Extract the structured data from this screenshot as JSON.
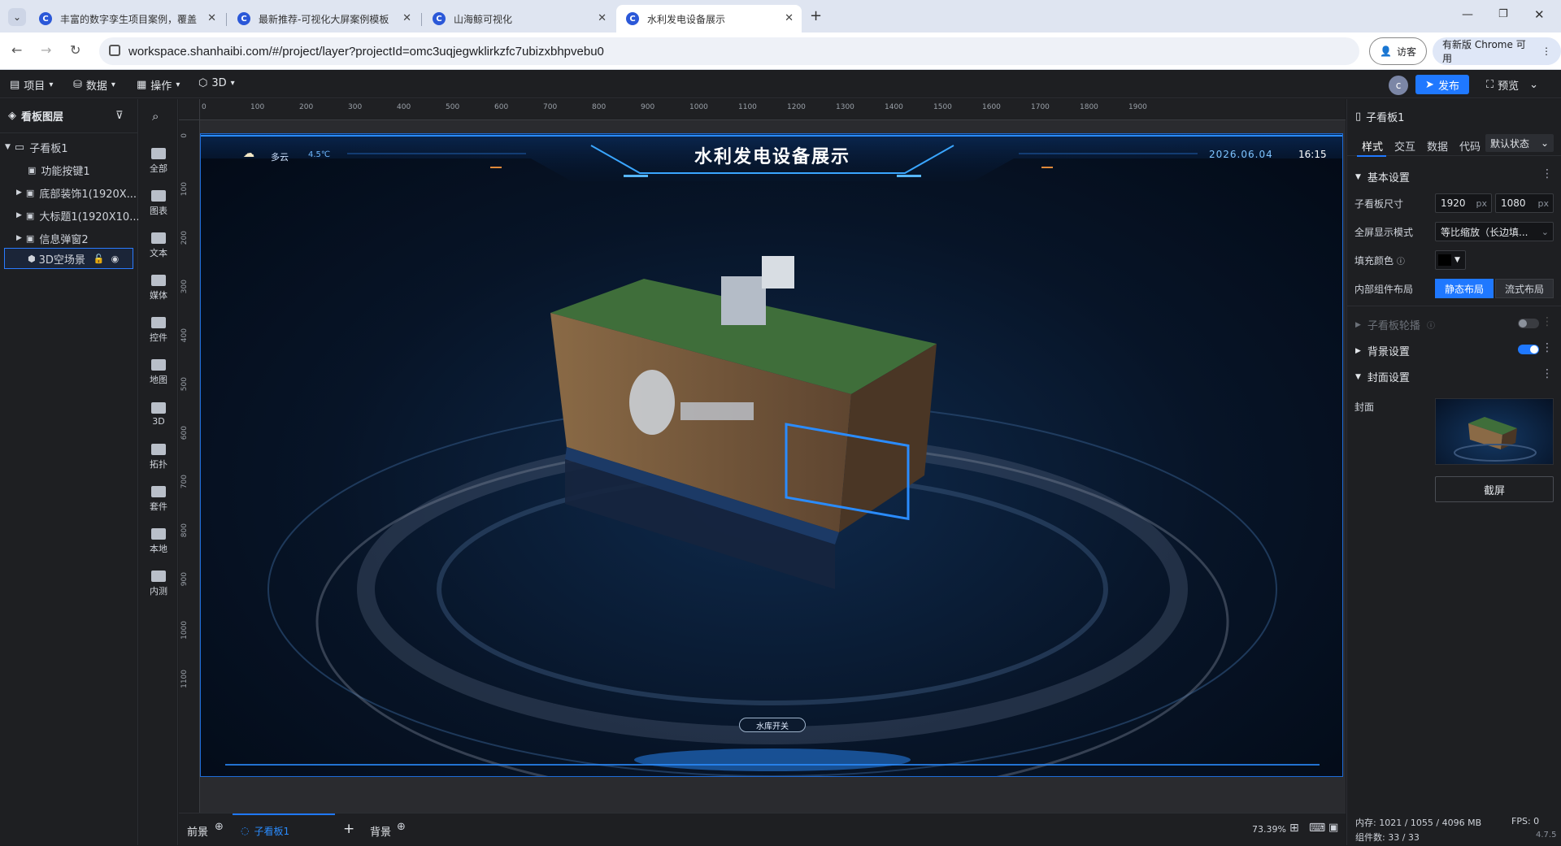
{
  "browser": {
    "tabs": [
      {
        "title": "丰富的数字孪生项目案例，覆盖"
      },
      {
        "title": "最新推荐-可视化大屏案例模板"
      },
      {
        "title": "山海鲸可视化"
      },
      {
        "title": "水利发电设备展示"
      }
    ],
    "url": "workspace.shanhaibi.com/#/project/layer?projectId=omc3uqjegwklirkzfc7ubizxbhpvebu0",
    "visitor_label": "访客",
    "update_label": "有新版 Chrome 可用"
  },
  "appbar": {
    "menus": [
      "项目",
      "数据",
      "操作",
      "3D"
    ],
    "avatar_letter": "c",
    "publish_label": "发布",
    "preview_label": "预览"
  },
  "layers": {
    "title": "看板图层",
    "items": [
      {
        "label": "子看板1"
      },
      {
        "label": "功能按键1"
      },
      {
        "label": "底部装饰1(1920X..."
      },
      {
        "label": "大标题1(1920X10..."
      },
      {
        "label": "信息弹窗2"
      },
      {
        "label": "3D空场景"
      }
    ]
  },
  "tools": [
    "全部",
    "图表",
    "文本",
    "媒体",
    "控件",
    "地图",
    "3D",
    "拓扑",
    "套件",
    "本地",
    "内测"
  ],
  "ruler": {
    "top": [
      "0",
      "100",
      "200",
      "300",
      "400",
      "500",
      "600",
      "700",
      "800",
      "900",
      "1000",
      "1100",
      "1200",
      "1300",
      "1400",
      "1500",
      "1600",
      "1700",
      "1800",
      "1900"
    ],
    "left": [
      "0",
      "100",
      "200",
      "300",
      "400",
      "500",
      "600",
      "700",
      "800",
      "900",
      "1000",
      "1100"
    ]
  },
  "dashboard": {
    "title": "水利发电设备展示",
    "weather": "多云",
    "temperature": "4.5℃",
    "date": "2026.06.04",
    "time": "16:15",
    "reservoir_button": "水库开关"
  },
  "bottom": {
    "foreground": "前景",
    "subboard_tab": "子看板1",
    "background": "背景",
    "zoom": "73.39%"
  },
  "props": {
    "title": "子看板1",
    "tabs": [
      "样式",
      "交互",
      "数据",
      "代码"
    ],
    "state_select": "默认状态",
    "basic_section": "基本设置",
    "size_label": "子看板尺寸",
    "width": "1920",
    "height": "1080",
    "unit": "px",
    "fullscreen_label": "全屏显示模式",
    "fullscreen_value": "等比缩放（长边填...",
    "fill_label": "填充颜色",
    "fill_color": "#000000",
    "layout_label": "内部组件布局",
    "layout_static": "静态布局",
    "layout_flow": "流式布局",
    "carousel_section": "子看板轮播",
    "bg_section": "背景设置",
    "cover_section": "封面设置",
    "cover_label": "封面",
    "screenshot_button": "截屏",
    "memory": "内存:  1021 / 1055 / 4096 MB",
    "fps": "FPS:  0",
    "components": "组件数: 33 / 33",
    "version": "4.7.5"
  },
  "colors": {
    "accent": "#1f78ff",
    "panel": "#1e1f22",
    "canvas_glow": "#2a8cff"
  }
}
